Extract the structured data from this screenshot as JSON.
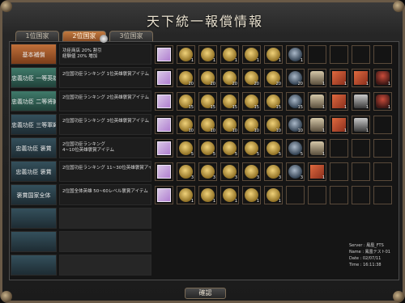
{
  "window": {
    "title": "天下統一報償情報"
  },
  "tabs": [
    {
      "label": "1位国家",
      "active": false
    },
    {
      "label": "2位国家",
      "active": true
    },
    {
      "label": "3位国家",
      "active": false
    }
  ],
  "rows": [
    {
      "category": "基本補償",
      "style": "orange",
      "desc": [
        "功臣商店 20% 割引",
        "経験値 20% 増加"
      ],
      "items": [
        {
          "icon": "scroll",
          "count": ""
        },
        {
          "icon": "coin",
          "count": "1"
        },
        {
          "icon": "coin",
          "count": "1"
        },
        {
          "icon": "coin",
          "count": "1"
        },
        {
          "icon": "coin",
          "count": "1"
        },
        {
          "icon": "coin",
          "count": "1"
        },
        {
          "icon": "orb",
          "count": "1"
        }
      ]
    },
    {
      "category": "忠義功臣 一等英雄",
      "style": "green",
      "desc": [
        "2位国功臣ランキング 1位英雄褒賞アイテム"
      ],
      "items": [
        {
          "icon": "scroll",
          "count": ""
        },
        {
          "icon": "coin",
          "count": "20"
        },
        {
          "icon": "coin",
          "count": "20"
        },
        {
          "icon": "coin",
          "count": "20"
        },
        {
          "icon": "coin",
          "count": "20"
        },
        {
          "icon": "coin",
          "count": "20"
        },
        {
          "icon": "orb",
          "count": "20"
        },
        {
          "icon": "armor",
          "count": "1"
        },
        {
          "icon": "book",
          "count": "1"
        },
        {
          "icon": "book",
          "count": "1"
        },
        {
          "icon": "helmet",
          "count": "1"
        }
      ]
    },
    {
      "category": "忠義功臣 二等将帥",
      "style": "green",
      "desc": [
        "2位国功臣ランキング 2位英雄褒賞アイテム"
      ],
      "items": [
        {
          "icon": "scroll",
          "count": ""
        },
        {
          "icon": "coin",
          "count": "15"
        },
        {
          "icon": "coin",
          "count": "15"
        },
        {
          "icon": "coin",
          "count": "15"
        },
        {
          "icon": "coin",
          "count": "15"
        },
        {
          "icon": "coin",
          "count": "15"
        },
        {
          "icon": "orb",
          "count": "15"
        },
        {
          "icon": "armor",
          "count": "1"
        },
        {
          "icon": "book",
          "count": "1"
        },
        {
          "icon": "horse",
          "count": "1"
        },
        {
          "icon": "helmet",
          "count": "1"
        }
      ]
    },
    {
      "category": "忠義功臣 三等軍師",
      "style": "empty",
      "desc": [
        "2位国功臣ランキング 3位英雄褒賞アイテム"
      ],
      "items": [
        {
          "icon": "scroll",
          "count": ""
        },
        {
          "icon": "coin",
          "count": "10"
        },
        {
          "icon": "coin",
          "count": "10"
        },
        {
          "icon": "coin",
          "count": "10"
        },
        {
          "icon": "coin",
          "count": "10"
        },
        {
          "icon": "coin",
          "count": "10"
        },
        {
          "icon": "orb",
          "count": "10"
        },
        {
          "icon": "armor",
          "count": "1"
        },
        {
          "icon": "book",
          "count": "1"
        },
        {
          "icon": "horse",
          "count": "1"
        }
      ]
    },
    {
      "category": "忠義功臣 褒賞",
      "style": "empty",
      "desc": [
        "2位国功臣ランキング",
        "4~10位英雄褒賞アイテム"
      ],
      "items": [
        {
          "icon": "scroll",
          "count": ""
        },
        {
          "icon": "coin",
          "count": "5"
        },
        {
          "icon": "coin",
          "count": "5"
        },
        {
          "icon": "coin",
          "count": "5"
        },
        {
          "icon": "coin",
          "count": "5"
        },
        {
          "icon": "coin",
          "count": "5"
        },
        {
          "icon": "orb",
          "count": "5"
        },
        {
          "icon": "armor",
          "count": "1"
        }
      ]
    },
    {
      "category": "忠義功臣 褒賞",
      "style": "empty",
      "desc": [
        "2位国功臣ランキング 11~30位英雄褒賞アイテム"
      ],
      "items": [
        {
          "icon": "scroll",
          "count": ""
        },
        {
          "icon": "coin",
          "count": "3"
        },
        {
          "icon": "coin",
          "count": "3"
        },
        {
          "icon": "coin",
          "count": "3"
        },
        {
          "icon": "coin",
          "count": "3"
        },
        {
          "icon": "coin",
          "count": "3"
        },
        {
          "icon": "orb",
          "count": "3"
        },
        {
          "icon": "book",
          "count": "1"
        }
      ]
    },
    {
      "category": "褒賞国家全体",
      "style": "empty",
      "desc": [
        "2位国全体英雄 50~60レベル褒賞アイテム"
      ],
      "items": [
        {
          "icon": "scroll",
          "count": ""
        },
        {
          "icon": "coin",
          "count": "1"
        },
        {
          "icon": "coin",
          "count": "1"
        },
        {
          "icon": "coin",
          "count": "1"
        },
        {
          "icon": "coin",
          "count": "1"
        },
        {
          "icon": "coin",
          "count": "1"
        }
      ]
    },
    {
      "category": "",
      "style": "empty",
      "desc": [],
      "items": []
    },
    {
      "category": "",
      "style": "empty",
      "desc": [],
      "items": []
    },
    {
      "category": "",
      "style": "empty",
      "desc": [],
      "items": []
    }
  ],
  "server_info": {
    "server": "Server : 鳳凰_FTS",
    "name": "Name : 鳳凰テスト01",
    "date": "Date : 02/07/11",
    "time": "Time : 16:11:38"
  },
  "buttons": {
    "confirm": "確認"
  }
}
